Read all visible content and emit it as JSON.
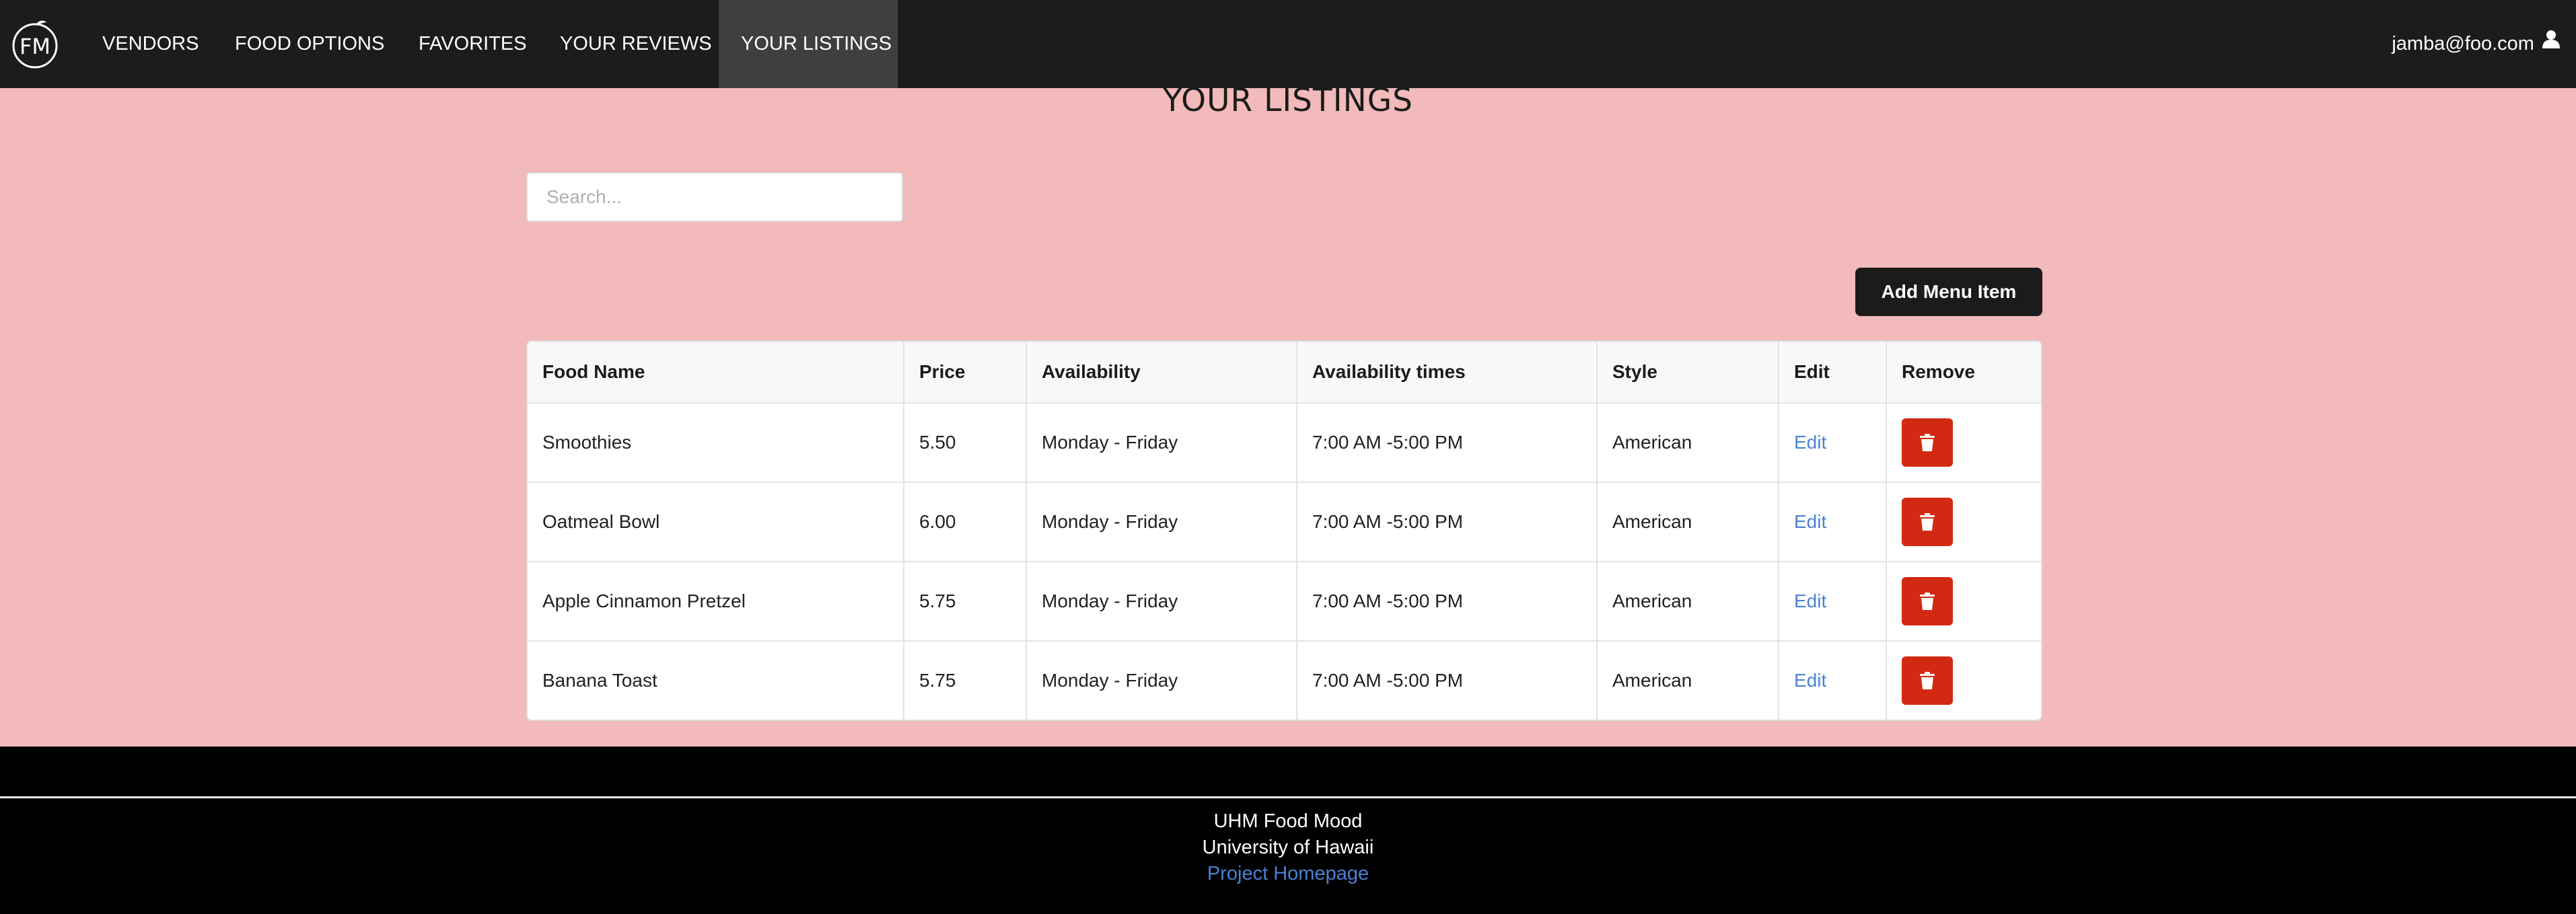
{
  "navbar": {
    "brand_initials": "FM",
    "items": [
      {
        "label": "VENDORS",
        "active": false
      },
      {
        "label": "FOOD OPTIONS",
        "active": false
      },
      {
        "label": "FAVORITES",
        "active": false
      },
      {
        "label": "YOUR REVIEWS",
        "active": false
      },
      {
        "label": "YOUR LISTINGS",
        "active": true
      }
    ],
    "user_email": "jamba@foo.com",
    "user_icon": "user-icon"
  },
  "page": {
    "title": "YOUR LISTINGS",
    "search_placeholder": "Search...",
    "add_button_label": "Add Menu Item"
  },
  "table": {
    "headers": [
      "Food Name",
      "Price",
      "Availability",
      "Availability times",
      "Style",
      "Edit",
      "Remove"
    ],
    "rows": [
      {
        "name": "Smoothies",
        "price": "5.50",
        "availability": "Monday - Friday",
        "times": "7:00 AM -5:00 PM",
        "style": "American",
        "edit": "Edit"
      },
      {
        "name": "Oatmeal Bowl",
        "price": "6.00",
        "availability": "Monday - Friday",
        "times": "7:00 AM -5:00 PM",
        "style": "American",
        "edit": "Edit"
      },
      {
        "name": "Apple Cinnamon Pretzel",
        "price": "5.75",
        "availability": "Monday - Friday",
        "times": "7:00 AM -5:00 PM",
        "style": "American",
        "edit": "Edit"
      },
      {
        "name": "Banana Toast",
        "price": "5.75",
        "availability": "Monday - Friday",
        "times": "7:00 AM -5:00 PM",
        "style": "American",
        "edit": "Edit"
      }
    ],
    "remove_icon": "trash-icon"
  },
  "footer": {
    "line1": "UHM Food Mood",
    "line2": "University of Hawaii",
    "link_label": "Project Homepage"
  },
  "colors": {
    "navbar_bg": "#1c1c1c",
    "page_bg": "#f2baba",
    "remove_button": "#d22a12",
    "link": "#4a82d4",
    "footer_bg": "#000000"
  }
}
